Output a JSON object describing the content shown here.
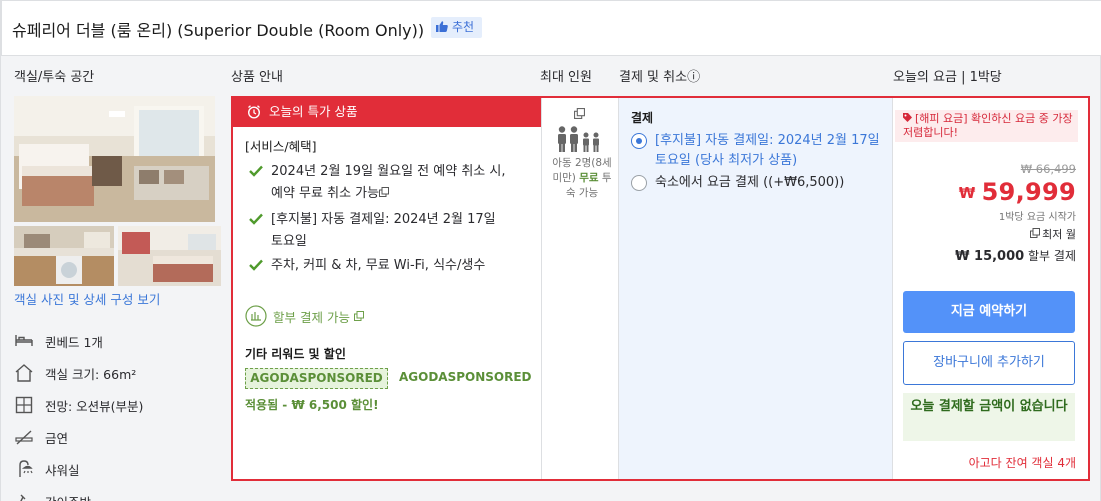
{
  "room": {
    "title": "슈페리어 더블 (룸 온리) (Superior Double (Room Only))",
    "recommend_label": "추천"
  },
  "columns": {
    "room_space": "객실/투숙 공간",
    "product_info": "상품 안내",
    "max_occupancy": "최대 인원",
    "payment_cancel": "결제 및 취소ⓘ",
    "today_rate": "오늘의 요금 | 1박당"
  },
  "left": {
    "photo_link": "객실 사진 및 상세 구성 보기",
    "features": [
      {
        "icon": "bed-icon",
        "label": "퀸베드 1개"
      },
      {
        "icon": "house-size-icon",
        "label": "객실 크기: 66m²"
      },
      {
        "icon": "window-view-icon",
        "label": "전망: 오션뷰(부분)"
      },
      {
        "icon": "no-smoking-icon",
        "label": "금연"
      },
      {
        "icon": "shower-icon",
        "label": "샤워실"
      },
      {
        "icon": "kitchen-icon",
        "label": "간이주방"
      }
    ]
  },
  "deal": {
    "banner": "오늘의 특가 상품",
    "services_title": "[서비스/혜택]",
    "bullets": [
      "2024년 2월 19일 월요일 전 예약 취소 시, 예약 무료 취소 가능",
      "[후지불] 자동 결제일: 2024년 2월 17일 토요일",
      "주차, 커피 & 차, 무료 Wi-Fi, 식수/생수"
    ],
    "installment": "할부 결제 가능",
    "reward_title": "기타 리워드 및 할인",
    "coupon_badge": "AGODASPONSORED",
    "coupon_code": "AGODASPONSORED",
    "applied": "적용됨 - ₩ 6,500 할인!"
  },
  "occupancy": {
    "text_before": "아동 2명(8세 미만)",
    "free": "무료",
    "text_after": "투숙 가능"
  },
  "payment": {
    "title": "결제",
    "options": [
      {
        "label": "[후지불] 자동 결제일: 2024년 2월 17일 토요일 (당사 최저가 상품)",
        "selected": true
      },
      {
        "label": "숙소에서 요금 결제 ((+₩6,500))",
        "selected": false
      }
    ]
  },
  "price": {
    "happy_rate": "[해피 요금] 확인하신 요금 중 가장 저렴합니다!",
    "original": "₩ 66,499",
    "currency": "₩",
    "current": "59,999",
    "per_night": "1박당 요금 시작가",
    "lowest": "최저 월",
    "installment_amount": "₩ 15,000",
    "installment_label": "할부 결제",
    "book_now": "지금 예약하기",
    "add_cart": "장바구니에 추가하기",
    "no_pay_today": "오늘 결제할 금액이 없습니다",
    "rooms_left": "아고다 잔여 객실 4개"
  },
  "colors": {
    "accent_red": "#e12d39",
    "link_blue": "#3b77d8",
    "button_blue": "#5392f9",
    "green": "#5b8f38"
  }
}
